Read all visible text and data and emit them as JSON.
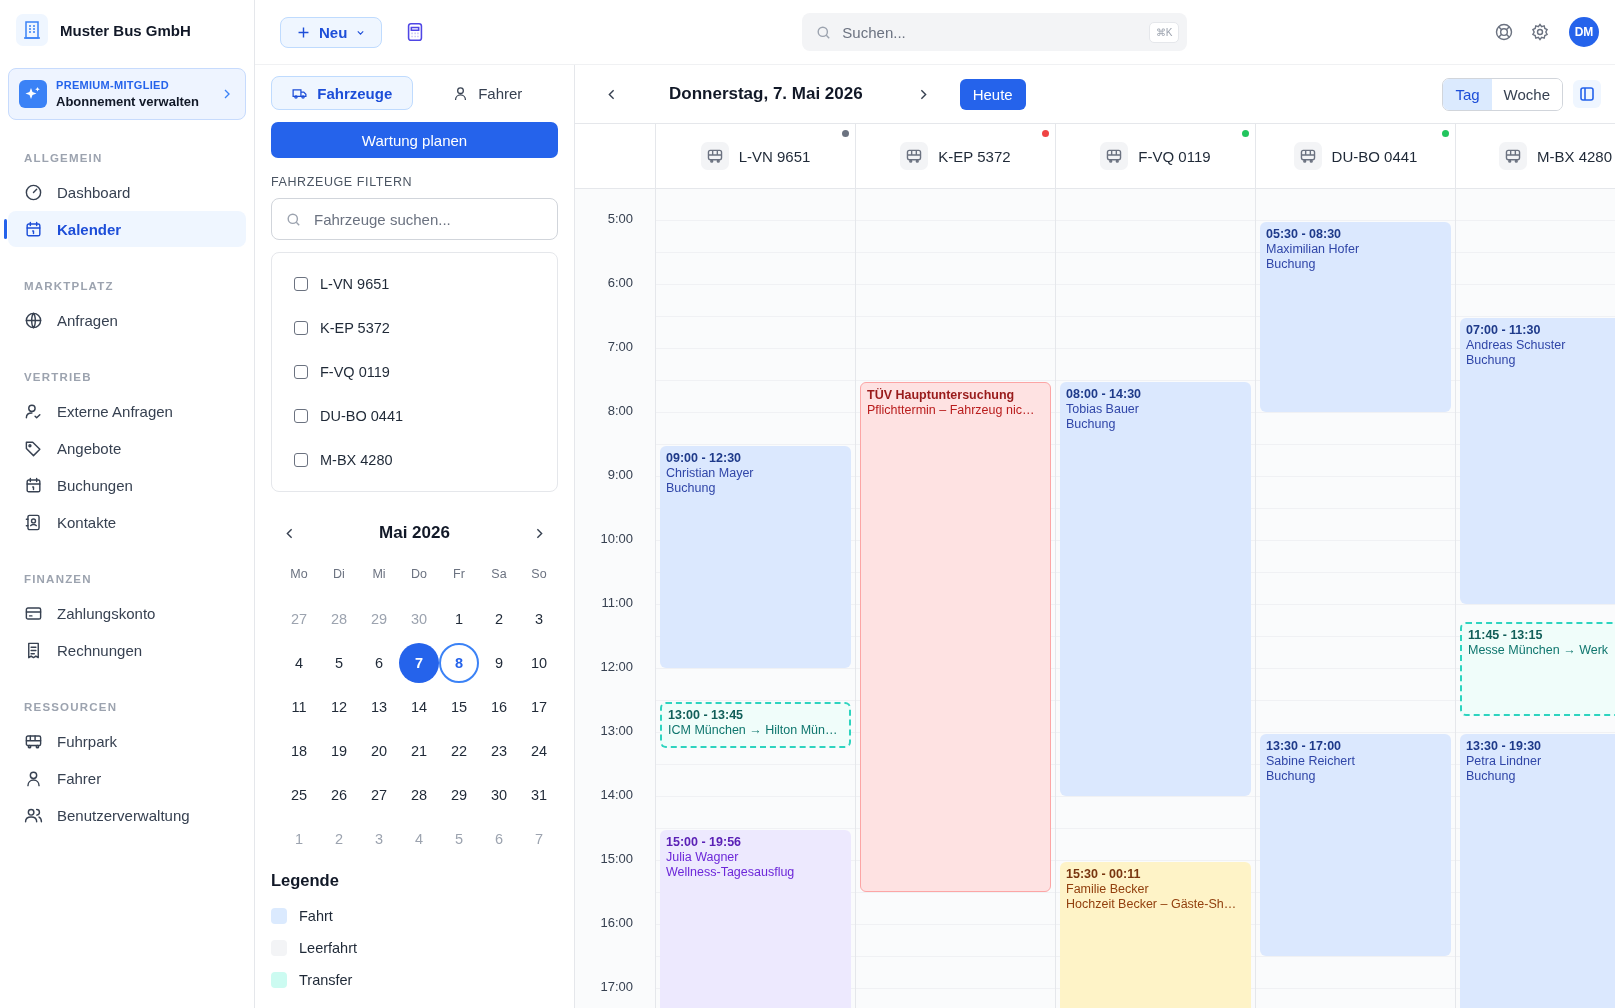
{
  "sidebar": {
    "company": "Muster Bus GmbH",
    "premium": {
      "badge": "PREMIUM-MITGLIED",
      "action": "Abonnement verwalten"
    },
    "sections": [
      {
        "title": "ALLGEMEIN",
        "items": [
          {
            "label": "Dashboard",
            "selected": false
          },
          {
            "label": "Kalender",
            "selected": true
          }
        ]
      },
      {
        "title": "MARKTPLATZ",
        "items": [
          {
            "label": "Anfragen",
            "selected": false
          }
        ]
      },
      {
        "title": "VERTRIEB",
        "items": [
          {
            "label": "Externe Anfragen",
            "selected": false
          },
          {
            "label": "Angebote",
            "selected": false
          },
          {
            "label": "Buchungen",
            "selected": false
          },
          {
            "label": "Kontakte",
            "selected": false
          }
        ]
      },
      {
        "title": "FINANZEN",
        "items": [
          {
            "label": "Zahlungskonto",
            "selected": false
          },
          {
            "label": "Rechnungen",
            "selected": false
          }
        ]
      },
      {
        "title": "RESSOURCEN",
        "items": [
          {
            "label": "Fuhrpark",
            "selected": false
          },
          {
            "label": "Fahrer",
            "selected": false
          },
          {
            "label": "Benutzerverwaltung",
            "selected": false
          }
        ]
      }
    ]
  },
  "topbar": {
    "new_button": "Neu",
    "search": {
      "placeholder": "Suchen...",
      "shortcut": "⌘K"
    },
    "avatar": "DM"
  },
  "panel": {
    "tabs": [
      {
        "label": "Fahrzeuge",
        "selected": true
      },
      {
        "label": "Fahrer",
        "selected": false
      }
    ],
    "action": "Wartung planen",
    "filter_label": "FAHRZEUGE FILTERN",
    "filter_search": {
      "placeholder": "Fahrzeuge suchen..."
    },
    "vehicles": [
      {
        "label": "L-VN 9651",
        "checked": false
      },
      {
        "label": "K-EP 5372",
        "checked": false
      },
      {
        "label": "F-VQ 0119",
        "checked": false
      },
      {
        "label": "DU-BO 0441",
        "checked": false
      },
      {
        "label": "M-BX 4280",
        "checked": false
      }
    ],
    "mini_calendar": {
      "month": "Mai 2026",
      "weekdays": [
        "Mo",
        "Di",
        "Mi",
        "Do",
        "Fr",
        "Sa",
        "So"
      ],
      "days": [
        {
          "day": "27",
          "outside": true,
          "selected": false,
          "today": false
        },
        {
          "day": "28",
          "outside": true,
          "selected": false,
          "today": false
        },
        {
          "day": "29",
          "outside": true,
          "selected": false,
          "today": false
        },
        {
          "day": "30",
          "outside": true,
          "selected": false,
          "today": false
        },
        {
          "day": "1",
          "outside": false,
          "selected": false,
          "today": false
        },
        {
          "day": "2",
          "outside": false,
          "selected": false,
          "today": false
        },
        {
          "day": "3",
          "outside": false,
          "selected": false,
          "today": false
        },
        {
          "day": "4",
          "outside": false,
          "selected": false,
          "today": false
        },
        {
          "day": "5",
          "outside": false,
          "selected": false,
          "today": false
        },
        {
          "day": "6",
          "outside": false,
          "selected": false,
          "today": false
        },
        {
          "day": "7",
          "outside": false,
          "selected": true,
          "today": false
        },
        {
          "day": "8",
          "outside": false,
          "selected": false,
          "today": true
        },
        {
          "day": "9",
          "outside": false,
          "selected": false,
          "today": false
        },
        {
          "day": "10",
          "outside": false,
          "selected": false,
          "today": false
        },
        {
          "day": "11",
          "outside": false,
          "selected": false,
          "today": false
        },
        {
          "day": "12",
          "outside": false,
          "selected": false,
          "today": false
        },
        {
          "day": "13",
          "outside": false,
          "selected": false,
          "today": false
        },
        {
          "day": "14",
          "outside": false,
          "selected": false,
          "today": false
        },
        {
          "day": "15",
          "outside": false,
          "selected": false,
          "today": false
        },
        {
          "day": "16",
          "outside": false,
          "selected": false,
          "today": false
        },
        {
          "day": "17",
          "outside": false,
          "selected": false,
          "today": false
        },
        {
          "day": "18",
          "outside": false,
          "selected": false,
          "today": false
        },
        {
          "day": "19",
          "outside": false,
          "selected": false,
          "today": false
        },
        {
          "day": "20",
          "outside": false,
          "selected": false,
          "today": false
        },
        {
          "day": "21",
          "outside": false,
          "selected": false,
          "today": false
        },
        {
          "day": "22",
          "outside": false,
          "selected": false,
          "today": false
        },
        {
          "day": "23",
          "outside": false,
          "selected": false,
          "today": false
        },
        {
          "day": "24",
          "outside": false,
          "selected": false,
          "today": false
        },
        {
          "day": "25",
          "outside": false,
          "selected": false,
          "today": false
        },
        {
          "day": "26",
          "outside": false,
          "selected": false,
          "today": false
        },
        {
          "day": "27",
          "outside": false,
          "selected": false,
          "today": false
        },
        {
          "day": "28",
          "outside": false,
          "selected": false,
          "today": false
        },
        {
          "day": "29",
          "outside": false,
          "selected": false,
          "today": false
        },
        {
          "day": "30",
          "outside": false,
          "selected": false,
          "today": false
        },
        {
          "day": "31",
          "outside": false,
          "selected": false,
          "today": false
        },
        {
          "day": "1",
          "outside": true,
          "selected": false,
          "today": false
        },
        {
          "day": "2",
          "outside": true,
          "selected": false,
          "today": false
        },
        {
          "day": "3",
          "outside": true,
          "selected": false,
          "today": false
        },
        {
          "day": "4",
          "outside": true,
          "selected": false,
          "today": false
        },
        {
          "day": "5",
          "outside": true,
          "selected": false,
          "today": false
        },
        {
          "day": "6",
          "outside": true,
          "selected": false,
          "today": false
        },
        {
          "day": "7",
          "outside": true,
          "selected": false,
          "today": false
        }
      ]
    },
    "legend": {
      "title": "Legende",
      "items": [
        {
          "label": "Fahrt",
          "color": "#dbeafe"
        },
        {
          "label": "Leerfahrt",
          "color": "#f3f4f6"
        },
        {
          "label": "Transfer",
          "color": "#ccfbf1"
        }
      ]
    }
  },
  "calendar": {
    "date": "Donnerstag, 7. Mai 2026",
    "today_button": "Heute",
    "views": [
      {
        "label": "Tag",
        "selected": true
      },
      {
        "label": "Woche",
        "selected": false
      }
    ],
    "hours": [
      "5:00",
      "6:00",
      "7:00",
      "8:00",
      "9:00",
      "10:00",
      "11:00",
      "12:00",
      "13:00",
      "14:00",
      "15:00",
      "16:00",
      "17:00"
    ],
    "columns": [
      {
        "vehicle": "L-VN 9651",
        "color": "#6b7280",
        "events": [
          {
            "kind": "booking",
            "time": "09:00 - 12:30",
            "title": "Christian Mayer",
            "subtitle": "Buchung"
          },
          {
            "kind": "transfer",
            "time": "13:00 - 13:45",
            "title": "ICM München → Hilton Mün…"
          },
          {
            "kind": "trip",
            "time": "15:00 - 19:56",
            "title": "Julia Wagner",
            "subtitle": "Wellness-Tagesausflug"
          }
        ]
      },
      {
        "vehicle": "K-EP 5372",
        "color": "#ef4444",
        "events": [
          {
            "kind": "inspection",
            "title": "TÜV Hauptuntersuchung",
            "subtitle": "Pflichttermin – Fahrzeug nic…"
          }
        ]
      },
      {
        "vehicle": "F-VQ 0119",
        "color": "#22c55e",
        "events": [
          {
            "kind": "booking",
            "time": "08:00 - 14:30",
            "title": "Tobias Bauer",
            "subtitle": "Buchung"
          },
          {
            "kind": "event",
            "time": "15:30 - 00:11",
            "title": "Familie Becker",
            "subtitle": "Hochzeit Becker – Gäste-Sh…"
          }
        ]
      },
      {
        "vehicle": "DU-BO 0441",
        "color": "#22c55e",
        "events": [
          {
            "kind": "booking",
            "time": "05:30 - 08:30",
            "title": "Maximilian Hofer",
            "subtitle": "Buchung"
          },
          {
            "kind": "booking",
            "time": "13:30 - 17:00",
            "title": "Sabine Reichert",
            "subtitle": "Buchung"
          }
        ]
      },
      {
        "vehicle": "M-BX 4280",
        "events": [
          {
            "kind": "booking",
            "time": "07:00 - 11:30",
            "title": "Andreas Schuster",
            "subtitle": "Buchung"
          },
          {
            "kind": "transfer",
            "time": "11:45 - 13:15",
            "title": "Messe München → Werk"
          },
          {
            "kind": "booking",
            "time": "13:30 - 19:30",
            "title": "Petra Lindner",
            "subtitle": "Buchung"
          }
        ]
      }
    ]
  }
}
